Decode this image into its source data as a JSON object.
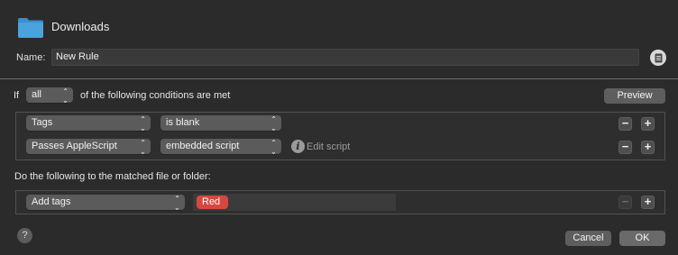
{
  "header": {
    "title": "Downloads",
    "folder_icon": "folder-icon",
    "folder_color": "#4aa3dc"
  },
  "name": {
    "label": "Name:",
    "value": "New Rule",
    "doc_icon": "document-icon"
  },
  "conditions": {
    "if_label": "If",
    "match_select": "all",
    "suffix": "of the following conditions are met",
    "preview_label": "Preview",
    "rows": [
      {
        "attribute": "Tags",
        "operator": "is blank"
      },
      {
        "attribute": "Passes AppleScript",
        "operator": "embedded script",
        "info_icon": "info-icon",
        "link": "Edit script"
      }
    ],
    "minus": "−",
    "plus": "+"
  },
  "actions": {
    "heading": "Do the following to the matched file or folder:",
    "rows": [
      {
        "action": "Add tags",
        "tag": "Red",
        "tag_color": "#d6483f"
      }
    ]
  },
  "footer": {
    "help": "?",
    "cancel_label": "Cancel",
    "ok_label": "OK"
  }
}
